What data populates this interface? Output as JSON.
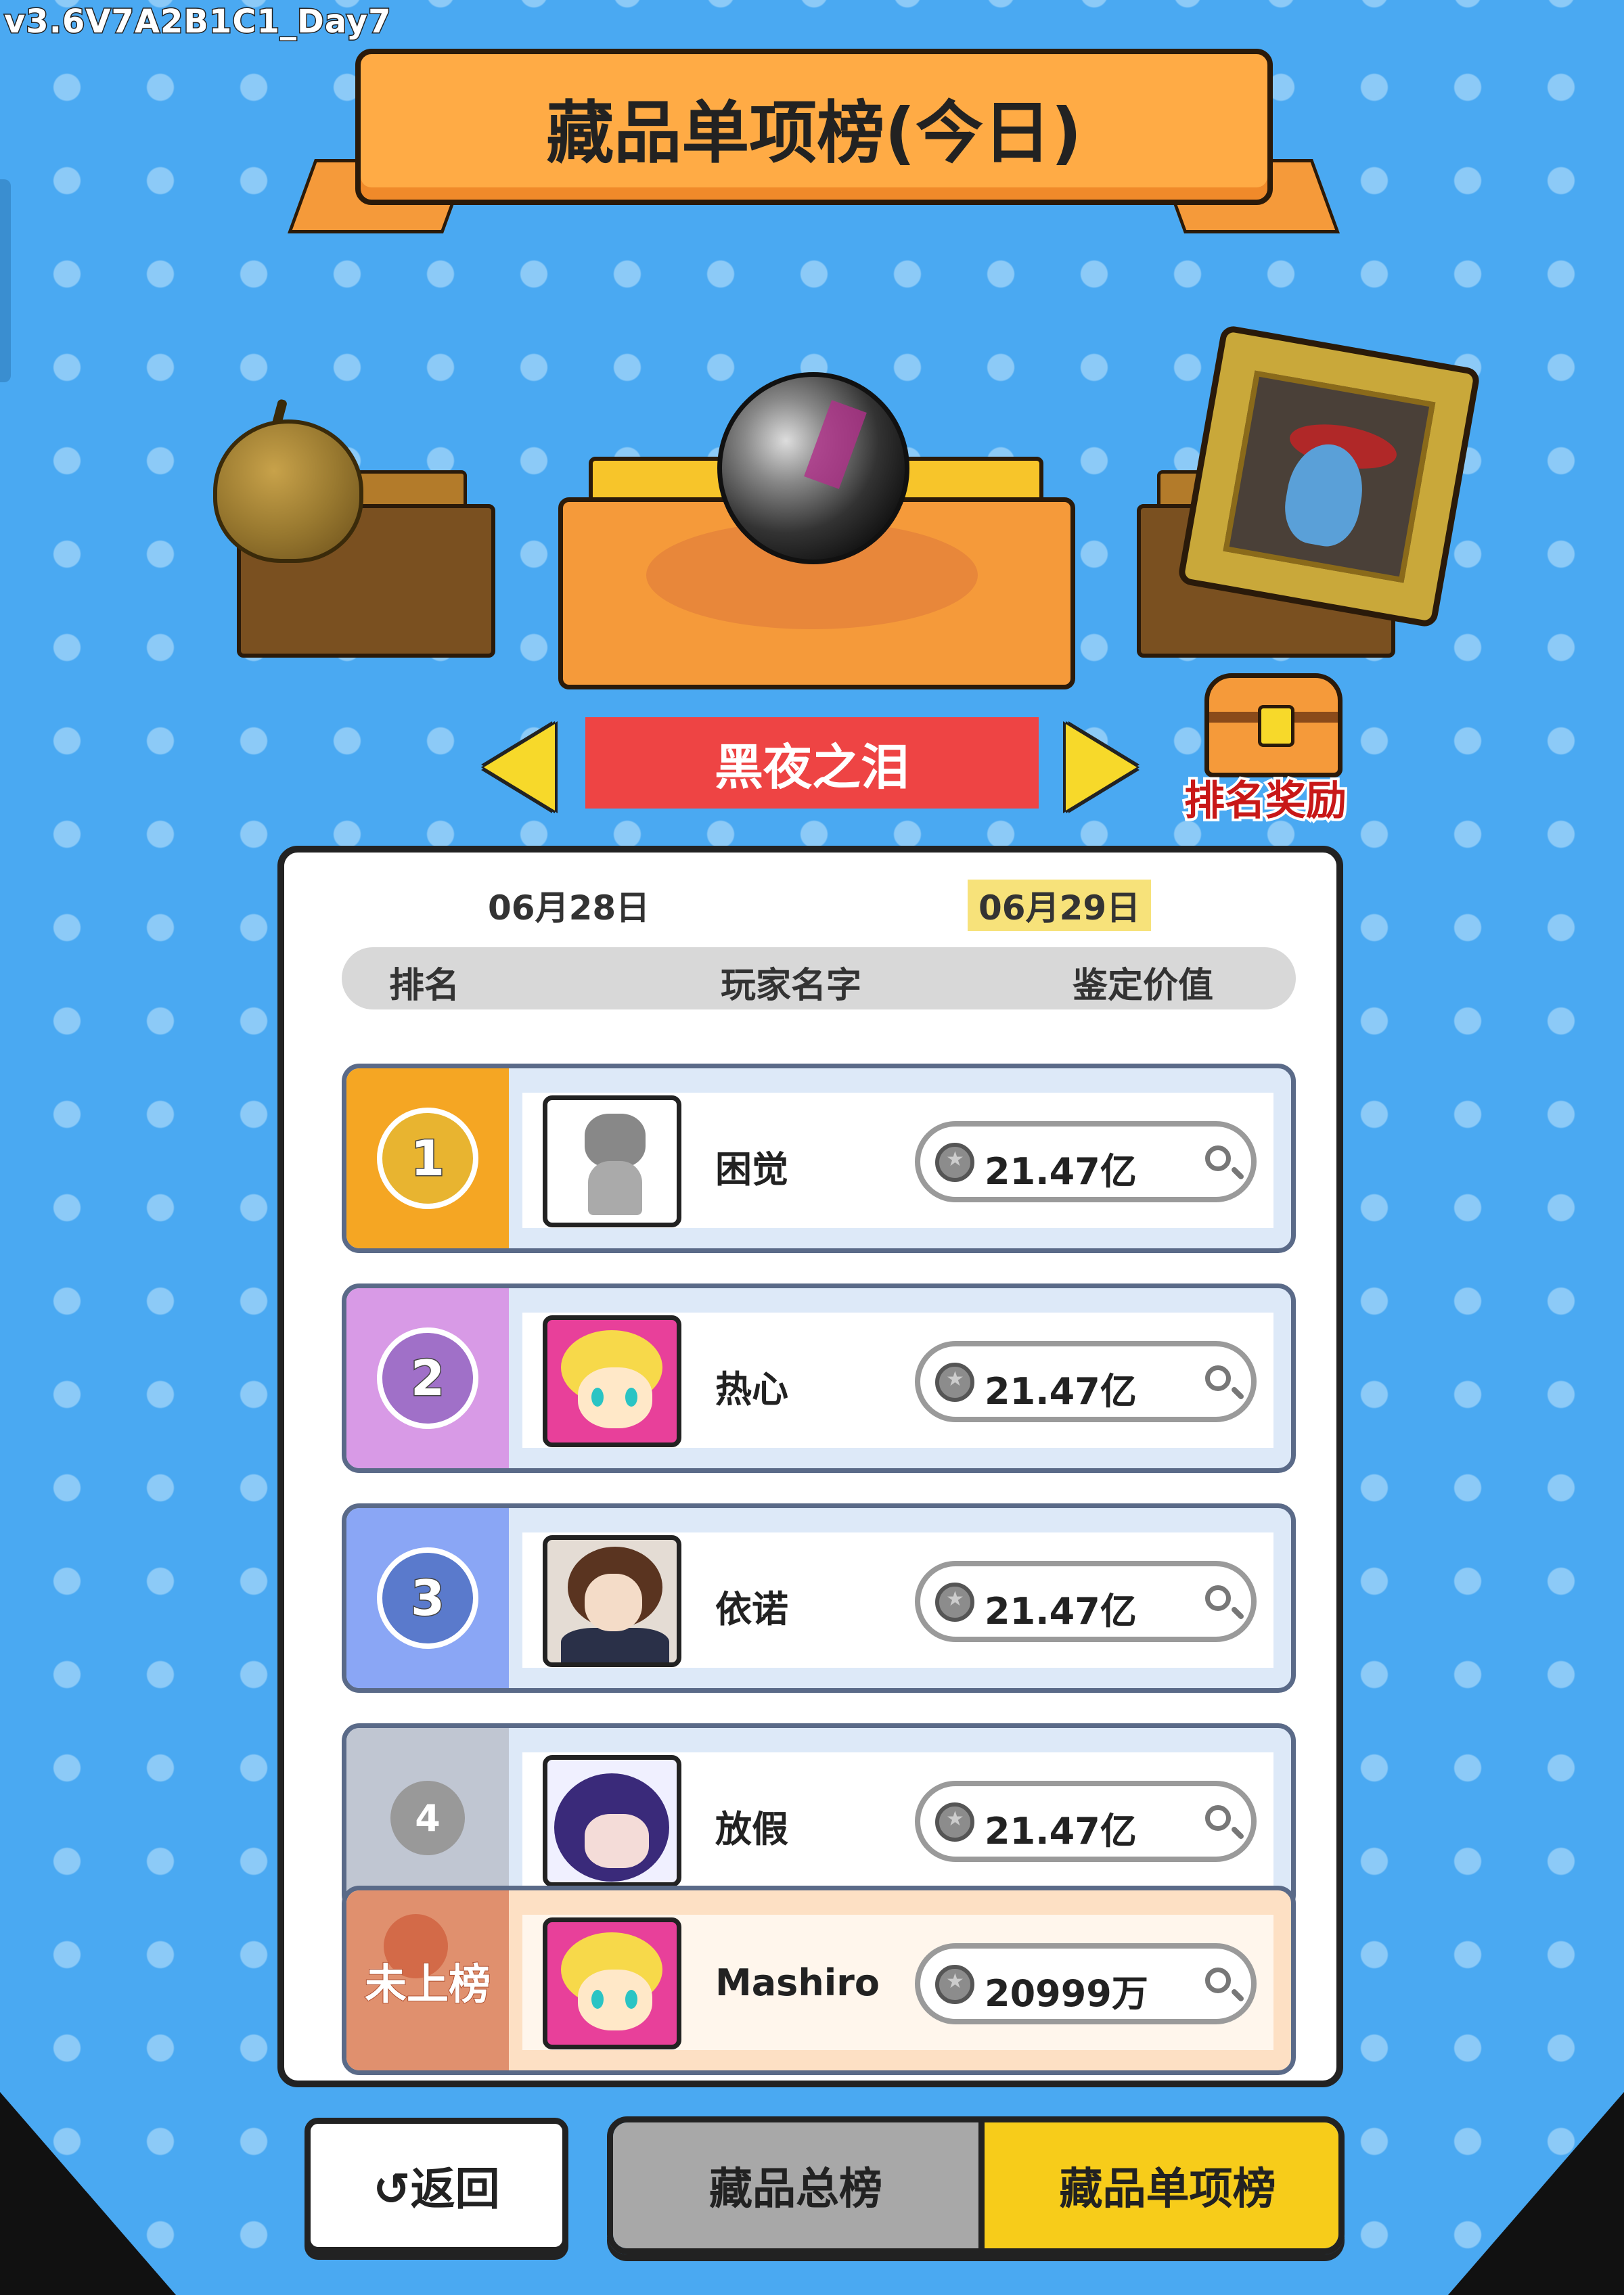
{
  "version": "v3.6V7A2B1C1_Day7",
  "title": "藏品单项榜(今日)",
  "selector": {
    "item_name": "黑夜之泪",
    "reward_label": "排名奖励"
  },
  "board": {
    "dates": [
      "06月28日",
      "06月29日"
    ],
    "selected_date": "06月29日",
    "headers": {
      "rank": "排名",
      "name": "玩家名字",
      "value": "鉴定价值"
    },
    "rows": [
      {
        "rank": "1",
        "name": "困觉",
        "value": "21.47亿",
        "avatar": "cat-avatar",
        "color": "#f5a623"
      },
      {
        "rank": "2",
        "name": "热心",
        "value": "21.47亿",
        "avatar": "blonde-girl-avatar",
        "color": "#d89ae6"
      },
      {
        "rank": "3",
        "name": "依诺",
        "value": "21.47亿",
        "avatar": "brown-hair-avatar",
        "color": "#8aa6f5"
      },
      {
        "rank": "4",
        "name": "放假",
        "value": "21.47亿",
        "avatar": "purple-hair-avatar",
        "color": "#c0c6d2"
      }
    ],
    "self": {
      "rank_label": "未上榜",
      "name": "Mashiro",
      "value": "20999万",
      "avatar": "blonde-girl-avatar",
      "color": "#e0906e"
    }
  },
  "buttons": {
    "back": "↺返回",
    "total": "藏品总榜",
    "single": "藏品单项榜"
  },
  "colors": {
    "background": "#4aa9f2",
    "banner": "#ffab45",
    "item_name_bar": "#ee4444",
    "active_tab": "#f7cc1a"
  }
}
